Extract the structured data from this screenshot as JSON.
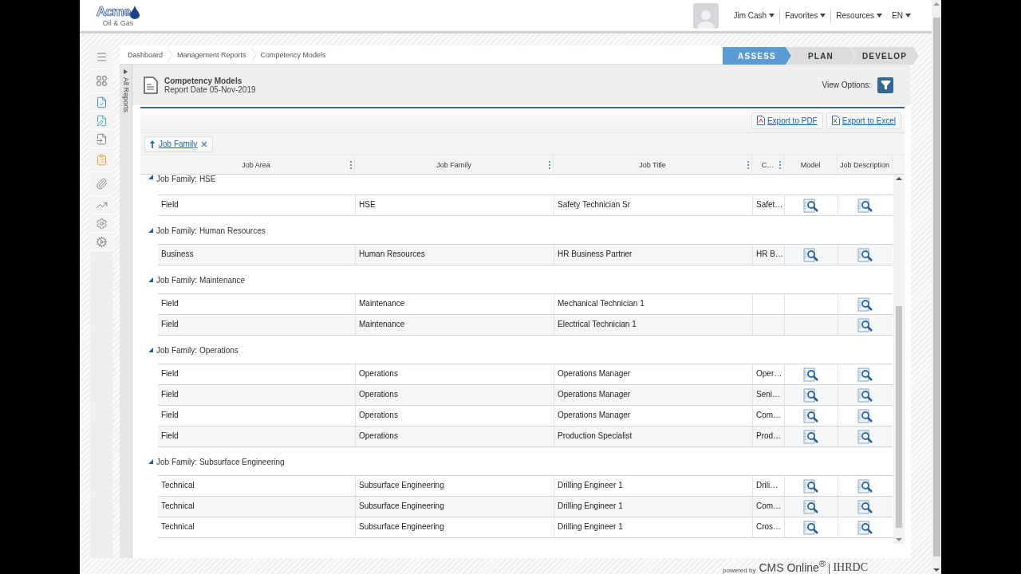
{
  "header": {
    "logo": {
      "name": "Acme",
      "tagline": "Oil & Gas"
    },
    "menus": [
      {
        "label": "Jim Cash"
      },
      {
        "label": "Favorites"
      },
      {
        "label": "Resources"
      },
      {
        "label": "EN"
      }
    ]
  },
  "reports_panel": {
    "label": "All Reports",
    "expanded": false
  },
  "breadcrumb": [
    "Dashboard",
    "Management Reports",
    "Competency Models"
  ],
  "stages": [
    {
      "label": "ASSESS",
      "selected": true
    },
    {
      "label": "PLAN",
      "selected": false
    },
    {
      "label": "DEVELOP",
      "selected": false
    }
  ],
  "report": {
    "title": "Competency Models",
    "date_label": "Report Date",
    "date": "05-Nov-2019",
    "view_options_label": "View Options:"
  },
  "exports": [
    {
      "label": "Export to PDF",
      "kind": "pdf"
    },
    {
      "label": "Export to Excel",
      "kind": "excel"
    }
  ],
  "grouping": [
    {
      "label": "Job Family"
    }
  ],
  "table": {
    "columns": [
      {
        "label": "Job Area",
        "menu": true
      },
      {
        "label": "Job Family",
        "menu": true
      },
      {
        "label": "Job Title",
        "menu": true
      },
      {
        "label": "C…",
        "menu": true
      },
      {
        "label": "Model",
        "menu": false
      },
      {
        "label": "Job Description",
        "menu": false
      }
    ],
    "groups": [
      {
        "label": "Job Family: HSE",
        "expanded": true,
        "rows": [
          {
            "cells": [
              "Field",
              "HSE",
              "Safety Technician Sr",
              "Safet…"
            ],
            "model": true,
            "description": true
          }
        ]
      },
      {
        "label": "Job Family: Human Resources",
        "expanded": true,
        "rows": [
          {
            "cells": [
              "Business",
              "Human Resources",
              "HR Business Partner",
              "HR B…"
            ],
            "model": true,
            "description": true
          }
        ]
      },
      {
        "label": "Job Family: Maintenance",
        "expanded": true,
        "rows": [
          {
            "cells": [
              "Field",
              "Maintenance",
              "Mechanical Technician 1",
              ""
            ],
            "model": false,
            "description": true
          },
          {
            "cells": [
              "Field",
              "Maintenance",
              "Electrical Technician 1",
              ""
            ],
            "model": false,
            "description": true
          }
        ]
      },
      {
        "label": "Job Family: Operations",
        "expanded": true,
        "rows": [
          {
            "cells": [
              "Field",
              "Operations",
              "Operations Manager",
              "Oper…"
            ],
            "model": true,
            "description": true
          },
          {
            "cells": [
              "Field",
              "Operations",
              "Operations Manager",
              "Seni…"
            ],
            "model": true,
            "description": true
          },
          {
            "cells": [
              "Field",
              "Operations",
              "Operations Manager",
              "Com…"
            ],
            "model": true,
            "description": true
          },
          {
            "cells": [
              "Field",
              "Operations",
              "Production Specialist",
              "Prod…"
            ],
            "model": true,
            "description": true
          }
        ]
      },
      {
        "label": "Job Family: Subsurface Engineering",
        "expanded": true,
        "rows": [
          {
            "cells": [
              "Technical",
              "Subsurface Engineering",
              "Drilling Engineer 1",
              "Drili…"
            ],
            "model": true,
            "description": true
          },
          {
            "cells": [
              "Technical",
              "Subsurface Engineering",
              "Drilling Engineer 1",
              "Com…"
            ],
            "model": true,
            "description": true
          },
          {
            "cells": [
              "Technical",
              "Subsurface Engineering",
              "Drilling Engineer 1",
              "Cros…"
            ],
            "model": true,
            "description": true
          }
        ]
      }
    ]
  },
  "footer": {
    "powered_by": "powered by",
    "product": "CMS Online$^{®}$",
    "company": "IHRDC"
  }
}
